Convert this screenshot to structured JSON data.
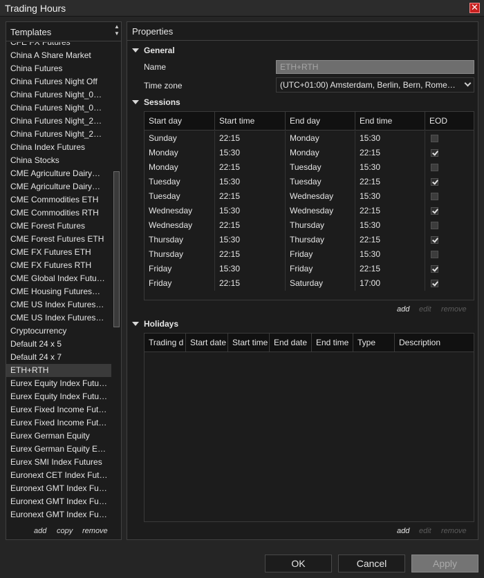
{
  "window": {
    "title": "Trading Hours",
    "close_glyph": "✕"
  },
  "templates": {
    "header": "Templates",
    "items": [
      "CFE FX Futures",
      "China A Share Market",
      "China Futures",
      "China Futures Night Off",
      "China Futures Night_0…",
      "China Futures Night_0…",
      "China Futures Night_2…",
      "China Futures Night_2…",
      "China Index Futures",
      "China Stocks",
      "CME Agriculture Dairy…",
      "CME Agriculture Dairy…",
      "CME Commodities ETH",
      "CME Commodities RTH",
      "CME Forest Futures",
      "CME Forest Futures ETH",
      "CME FX Futures ETH",
      "CME FX Futures RTH",
      "CME Global Index Futu…",
      "CME Housing Futures…",
      "CME US Index Futures…",
      "CME US Index Futures…",
      "Cryptocurrency",
      "Default 24 x 5",
      "Default 24 x 7",
      "ETH+RTH",
      "Eurex Equity Index Futu…",
      "Eurex Equity Index Futu…",
      "Eurex Fixed Income Fut…",
      "Eurex Fixed Income Fut…",
      "Eurex German Equity",
      "Eurex German Equity E…",
      "Eurex SMI Index Futures",
      "Euronext CET Index Fut…",
      "Euronext GMT Index Fu…",
      "Euronext GMT Index Fu…",
      "Euronext GMT Index Fu…"
    ],
    "selected_index": 25,
    "footer": {
      "add": "add",
      "copy": "copy",
      "remove": "remove"
    }
  },
  "properties": {
    "header": "Properties",
    "general": {
      "title": "General",
      "name_label": "Name",
      "name_value": "ETH+RTH",
      "timezone_label": "Time zone",
      "timezone_value": "(UTC+01:00) Amsterdam, Berlin, Bern, Rome…"
    },
    "sessions": {
      "title": "Sessions",
      "columns": [
        "Start day",
        "Start time",
        "End day",
        "End time",
        "EOD"
      ],
      "rows": [
        {
          "start_day": "Sunday",
          "start_time": "22:15",
          "end_day": "Monday",
          "end_time": "15:30",
          "eod": false
        },
        {
          "start_day": "Monday",
          "start_time": "15:30",
          "end_day": "Monday",
          "end_time": "22:15",
          "eod": true
        },
        {
          "start_day": "Monday",
          "start_time": "22:15",
          "end_day": "Tuesday",
          "end_time": "15:30",
          "eod": false
        },
        {
          "start_day": "Tuesday",
          "start_time": "15:30",
          "end_day": "Tuesday",
          "end_time": "22:15",
          "eod": true
        },
        {
          "start_day": "Tuesday",
          "start_time": "22:15",
          "end_day": "Wednesday",
          "end_time": "15:30",
          "eod": false
        },
        {
          "start_day": "Wednesday",
          "start_time": "15:30",
          "end_day": "Wednesday",
          "end_time": "22:15",
          "eod": true
        },
        {
          "start_day": "Wednesday",
          "start_time": "22:15",
          "end_day": "Thursday",
          "end_time": "15:30",
          "eod": false
        },
        {
          "start_day": "Thursday",
          "start_time": "15:30",
          "end_day": "Thursday",
          "end_time": "22:15",
          "eod": true
        },
        {
          "start_day": "Thursday",
          "start_time": "22:15",
          "end_day": "Friday",
          "end_time": "15:30",
          "eod": false
        },
        {
          "start_day": "Friday",
          "start_time": "15:30",
          "end_day": "Friday",
          "end_time": "22:15",
          "eod": true
        },
        {
          "start_day": "Friday",
          "start_time": "22:15",
          "end_day": "Saturday",
          "end_time": "17:00",
          "eod": true
        }
      ],
      "actions": {
        "add": "add",
        "edit": "edit",
        "remove": "remove"
      }
    },
    "holidays": {
      "title": "Holidays",
      "columns": [
        "Trading d",
        "Start date",
        "Start time",
        "End date",
        "End time",
        "Type",
        "Description"
      ],
      "rows": [],
      "actions": {
        "add": "add",
        "edit": "edit",
        "remove": "remove"
      }
    }
  },
  "buttons": {
    "ok": "OK",
    "cancel": "Cancel",
    "apply": "Apply"
  }
}
